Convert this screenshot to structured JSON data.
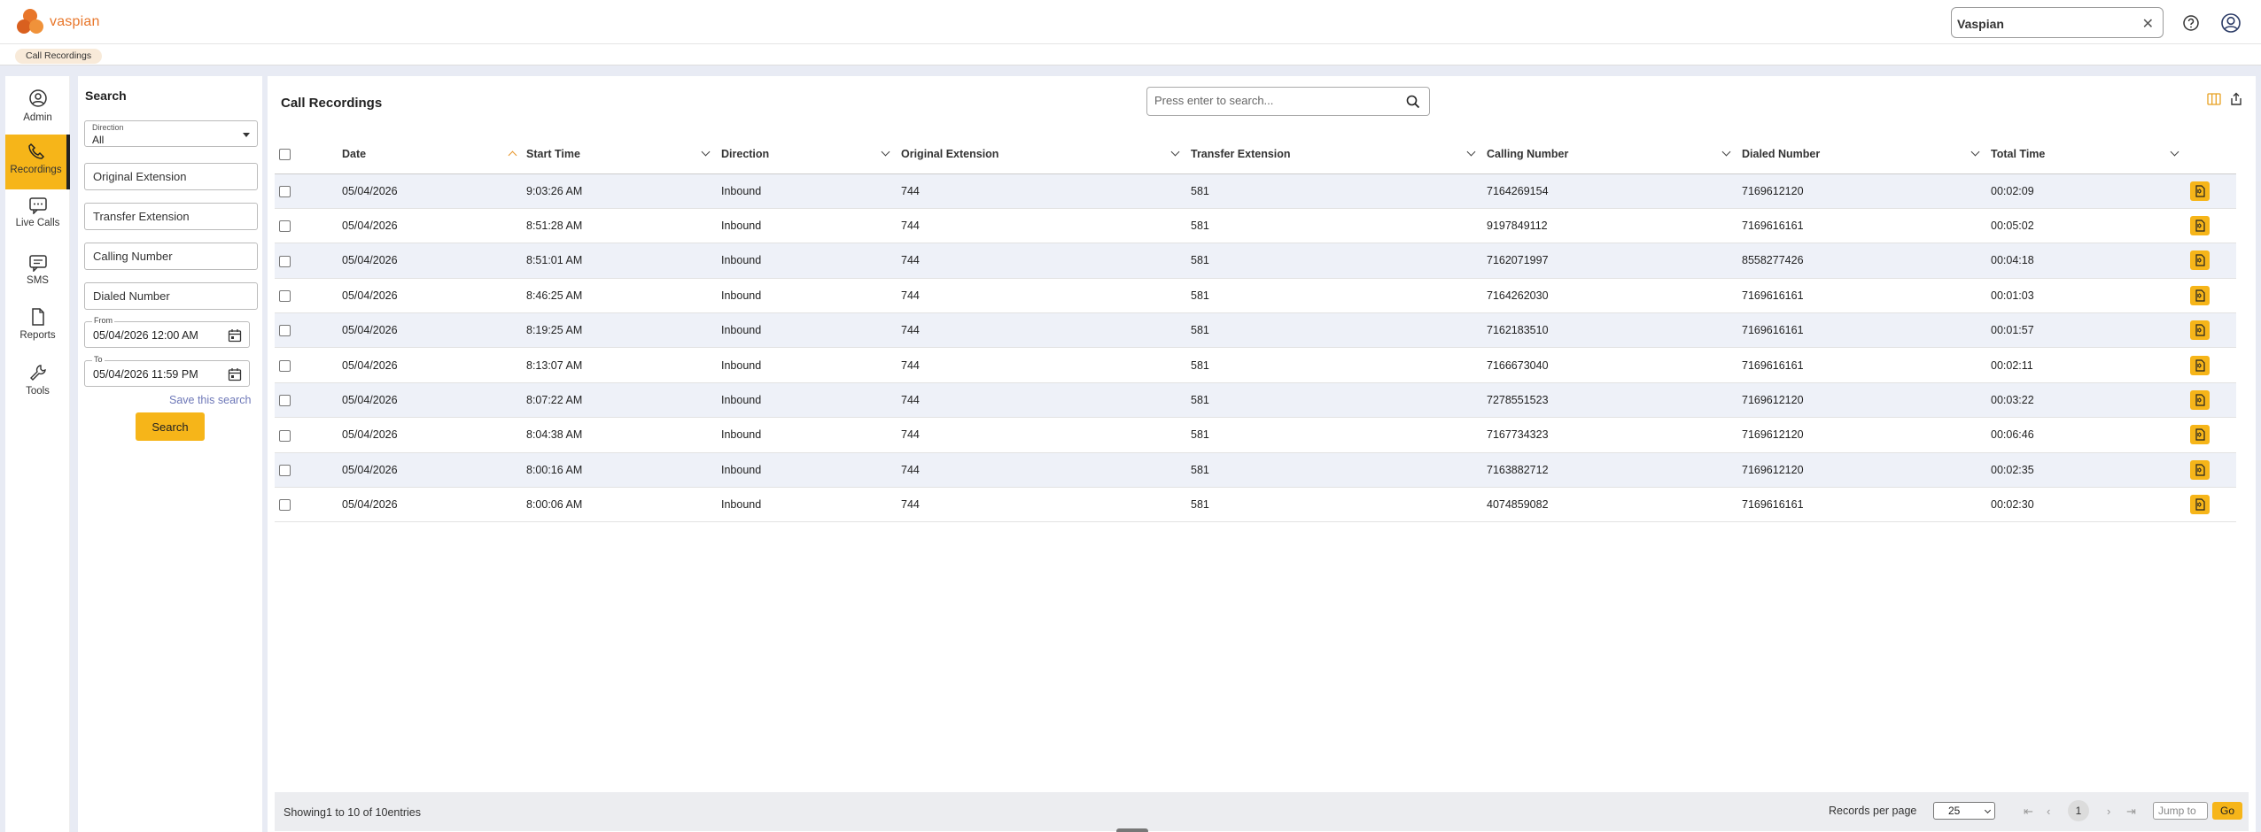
{
  "app": {
    "logo_text": "vaspian",
    "brand_color": "#f6b519",
    "org_selector": {
      "value": "Vaspian",
      "clear_icon": "close-icon"
    },
    "icons": [
      "help-icon",
      "user-icon"
    ]
  },
  "breadcrumb": {
    "label": "Call Recordings"
  },
  "nav": [
    {
      "label": "Admin",
      "icon": "admin-icon",
      "active": false
    },
    {
      "label": "Recordings",
      "icon": "phone-icon",
      "active": true
    },
    {
      "label": "Live Calls",
      "icon": "live-calls-icon",
      "active": false
    },
    {
      "label": "SMS",
      "icon": "sms-icon",
      "active": false
    },
    {
      "label": "Reports",
      "icon": "reports-icon",
      "active": false
    },
    {
      "label": "Tools",
      "icon": "tools-icon",
      "active": false
    }
  ],
  "search_panel": {
    "title": "Search",
    "direction": {
      "caption": "Direction",
      "value": "All"
    },
    "original_extension_placeholder": "Original Extension",
    "transfer_extension_placeholder": "Transfer Extension",
    "calling_number_placeholder": "Calling Number",
    "dialed_number_placeholder": "Dialed Number",
    "from": {
      "caption": "From",
      "value": "05/04/2026 12:00 AM"
    },
    "to": {
      "caption": "To",
      "value": "05/04/2026 11:59 PM"
    },
    "save_link": "Save this search",
    "search_button": "Search"
  },
  "main": {
    "title": "Call Recordings",
    "search_placeholder": "Press enter to search...",
    "columns": [
      "Date",
      "Start Time",
      "Direction",
      "Original Extension",
      "Transfer Extension",
      "Calling Number",
      "Dialed Number",
      "Total Time"
    ],
    "sorted_column": "Date",
    "rows": [
      [
        "05/04/2026",
        "9:03:26 AM",
        "Inbound",
        "744",
        "581",
        "7164269154",
        "7169612120",
        "00:02:09"
      ],
      [
        "05/04/2026",
        "8:51:28 AM",
        "Inbound",
        "744",
        "581",
        "9197849112",
        "7169616161",
        "00:05:02"
      ],
      [
        "05/04/2026",
        "8:51:01 AM",
        "Inbound",
        "744",
        "581",
        "7162071997",
        "8558277426",
        "00:04:18"
      ],
      [
        "05/04/2026",
        "8:46:25 AM",
        "Inbound",
        "744",
        "581",
        "7164262030",
        "7169616161",
        "00:01:03"
      ],
      [
        "05/04/2026",
        "8:19:25 AM",
        "Inbound",
        "744",
        "581",
        "7162183510",
        "7169616161",
        "00:01:57"
      ],
      [
        "05/04/2026",
        "8:13:07 AM",
        "Inbound",
        "744",
        "581",
        "7166673040",
        "7169616161",
        "00:02:11"
      ],
      [
        "05/04/2026",
        "8:07:22 AM",
        "Inbound",
        "744",
        "581",
        "7278551523",
        "7169612120",
        "00:03:22"
      ],
      [
        "05/04/2026",
        "8:04:38 AM",
        "Inbound",
        "744",
        "581",
        "7167734323",
        "7169612120",
        "00:06:46"
      ],
      [
        "05/04/2026",
        "8:00:16 AM",
        "Inbound",
        "744",
        "581",
        "7163882712",
        "7169612120",
        "00:02:35"
      ],
      [
        "05/04/2026",
        "8:00:06 AM",
        "Inbound",
        "744",
        "581",
        "4074859082",
        "7169616161",
        "00:02:30"
      ]
    ]
  },
  "footer": {
    "showing": "Showing1 to 10 of 10entries",
    "records_per_page_label": "Records per page",
    "records_per_page": "25",
    "current_page": "1",
    "jump_placeholder": "Jump to",
    "go_label": "Go"
  }
}
